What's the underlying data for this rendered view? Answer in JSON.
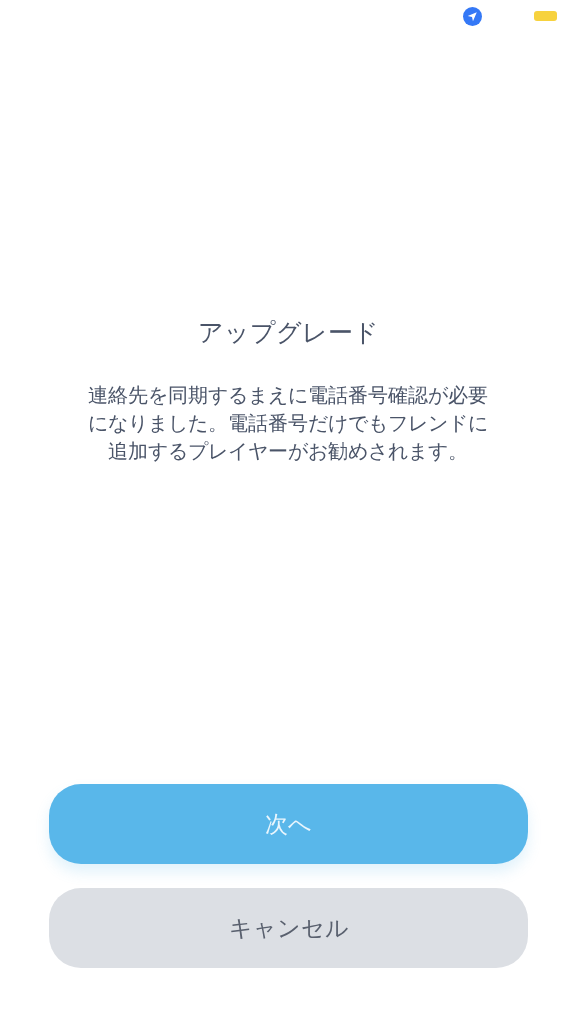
{
  "dialog": {
    "title": "アップグレード",
    "message": "連絡先を同期するまえに電話番号確認が必要になりました。電話番号だけでもフレンドに追加するプレイヤーがお勧めされます。"
  },
  "buttons": [
    {
      "label": "次へ",
      "kind": "primary"
    },
    {
      "label": "キャンセル",
      "kind": "secondary"
    }
  ]
}
